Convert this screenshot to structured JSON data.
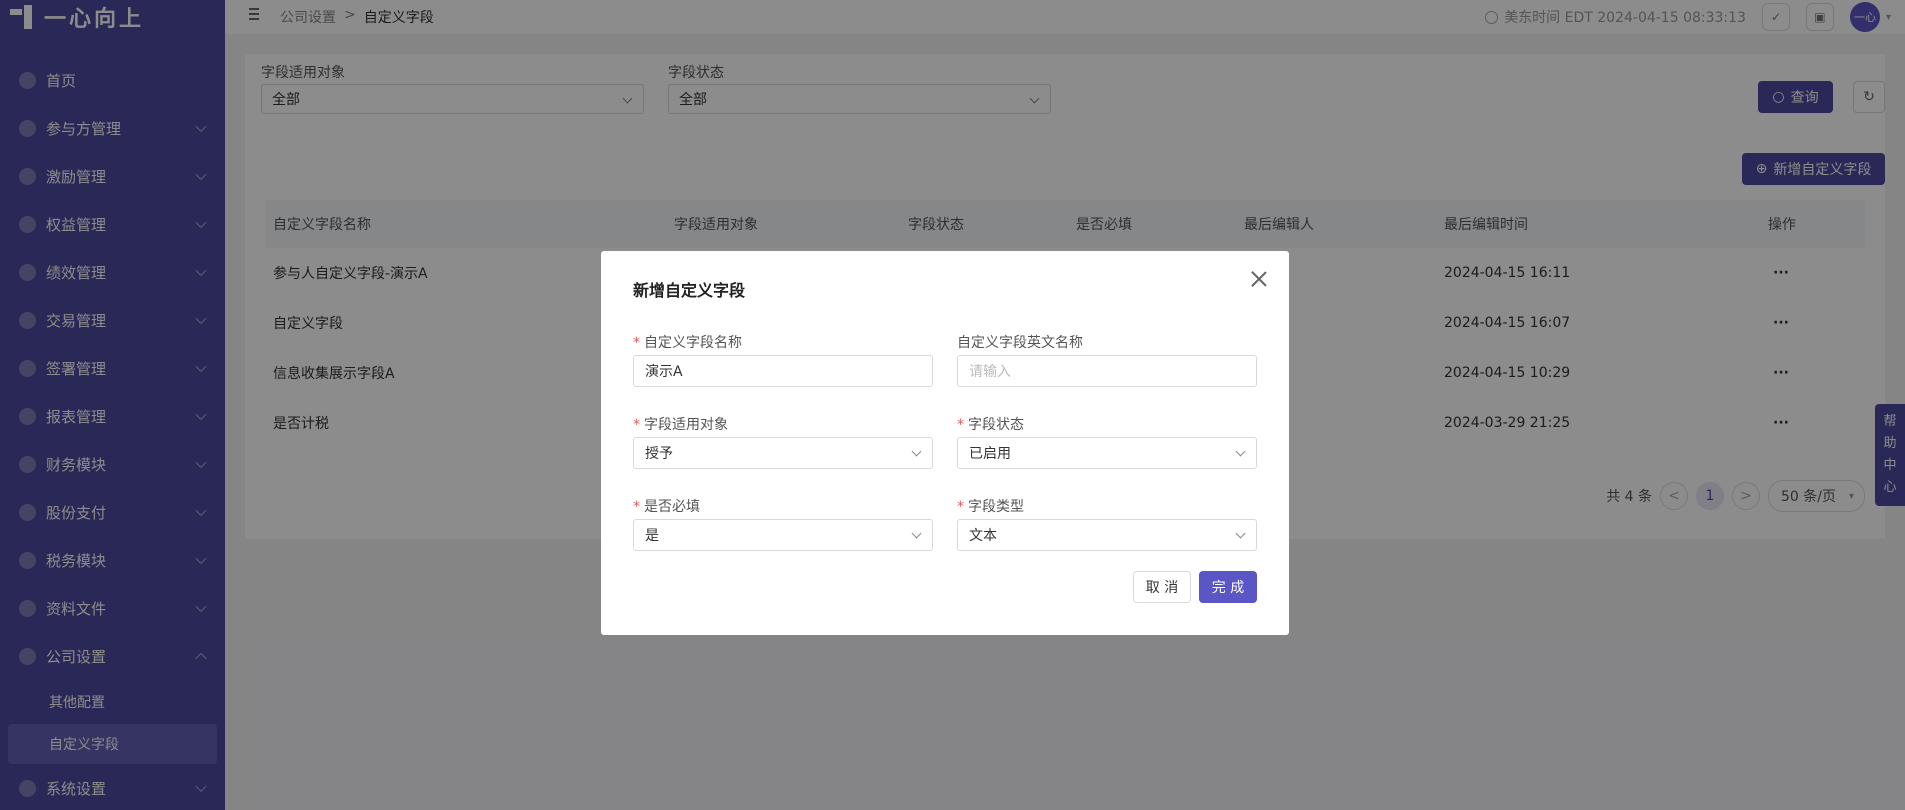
{
  "app": {
    "logo_text": "一心向上"
  },
  "sidebar": {
    "items": [
      {
        "label": "首页"
      },
      {
        "label": "参与方管理"
      },
      {
        "label": "激励管理"
      },
      {
        "label": "权益管理"
      },
      {
        "label": "绩效管理"
      },
      {
        "label": "交易管理"
      },
      {
        "label": "签署管理"
      },
      {
        "label": "报表管理"
      },
      {
        "label": "财务模块"
      },
      {
        "label": "股份支付"
      },
      {
        "label": "税务模块"
      },
      {
        "label": "资料文件"
      },
      {
        "label": "公司设置"
      },
      {
        "label": "系统设置"
      }
    ],
    "sub_items": [
      {
        "label": "其他配置"
      },
      {
        "label": "自定义字段"
      }
    ]
  },
  "header": {
    "breadcrumb": [
      "公司设置",
      ">",
      "自定义字段"
    ],
    "time": "美东时间 EDT 2024-04-15 08:33:13",
    "avatar": "一心"
  },
  "filters": {
    "target_label": "字段适用对象",
    "target_value": "全部",
    "status_label": "字段状态",
    "status_value": "全部",
    "query_label": "查询",
    "add_label": "新增自定义字段"
  },
  "table": {
    "headers": [
      "自定义字段名称",
      "字段适用对象",
      "字段状态",
      "是否必填",
      "最后编辑人",
      "最后编辑时间",
      "操作"
    ],
    "rows": [
      {
        "name": "参与人自定义字段-演示A",
        "time": "2024-04-15 16:11",
        "op": "···"
      },
      {
        "name": "自定义字段",
        "time": "2024-04-15 16:07",
        "op": "···"
      },
      {
        "name": "信息收集展示字段A",
        "time": "2024-04-15 10:29",
        "op": "···"
      },
      {
        "name": "是否计税",
        "time": "2024-03-29 21:25",
        "op": "···"
      }
    ]
  },
  "pager": {
    "total": "共 4 条",
    "prev": "<",
    "current": "1",
    "next": ">",
    "size": "50 条/页"
  },
  "help": {
    "chars": [
      "帮",
      "助",
      "中",
      "心"
    ]
  },
  "modal": {
    "title": "新增自定义字段",
    "name_label": "自定义字段名称",
    "name_value": "演示A",
    "en_label": "自定义字段英文名称",
    "en_placeholder": "请输入",
    "target_label": "字段适用对象",
    "target_value": "授予",
    "status_label": "字段状态",
    "status_value": "已启用",
    "required_label": "是否必填",
    "required_value": "是",
    "type_label": "字段类型",
    "type_value": "文本",
    "cancel": "取 消",
    "ok": "完 成",
    "req_mark": "*"
  },
  "colors": {
    "brand": "#4e4a9e",
    "primary_button": "#5b56c5",
    "required": "#e05a5a"
  }
}
